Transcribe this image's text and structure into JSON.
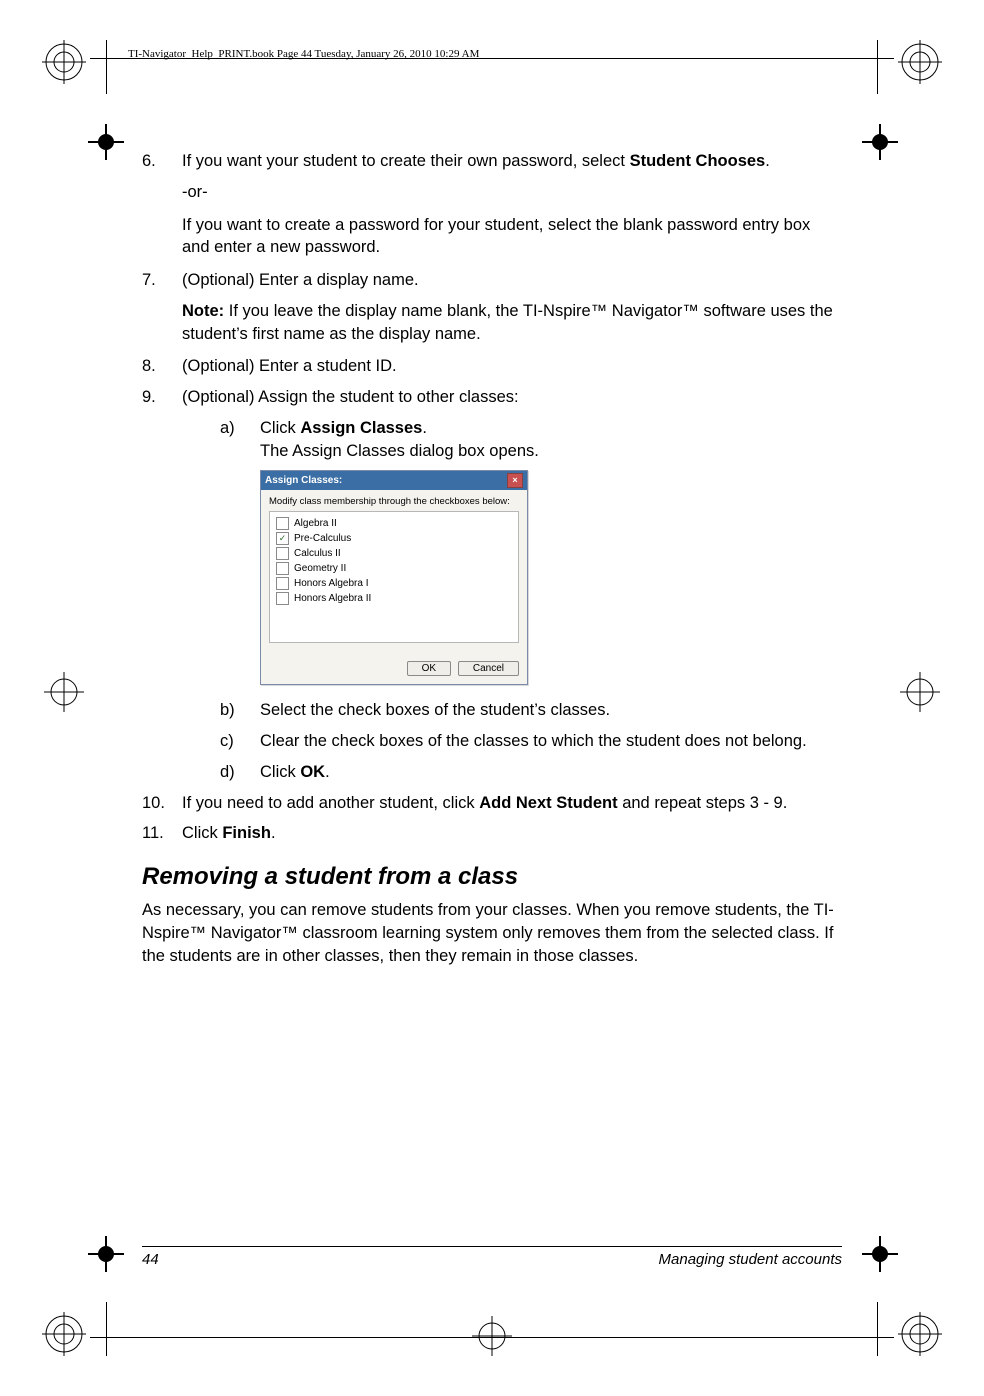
{
  "head_slug": "TI-Navigator_Help_PRINT.book  Page 44  Tuesday, January 26, 2010  10:29 AM",
  "step6": {
    "num": "6.",
    "text_a": "If you want your student to create their own password, select ",
    "bold_a": "Student Chooses",
    "text_b": ".",
    "or": "-or-",
    "text_c": "If you want to create a password for your student, select the blank password entry box and enter a new password."
  },
  "step7": {
    "num": "7.",
    "text": "(Optional) Enter a display name.",
    "note_label": "Note:",
    "note_text": " If you leave the display name blank, the TI-Nspire™ Navigator™ software uses the student’s first name as the display name."
  },
  "step8": {
    "num": "8.",
    "text": "(Optional) Enter a student ID."
  },
  "step9": {
    "num": "9.",
    "text": "(Optional) Assign the student to other classes:",
    "a_lbl": "a)",
    "a_line1": "Click ",
    "a_bold": "Assign Classes",
    "a_line1b": ".",
    "a_line2": "The Assign Classes dialog box opens.",
    "b_lbl": "b)",
    "b_text": "Select the check boxes of the student’s classes.",
    "c_lbl": "c)",
    "c_text": "Clear the check boxes of the classes to which the student does not belong.",
    "d_lbl": "d)",
    "d_text_a": "Click ",
    "d_bold": "OK",
    "d_text_b": "."
  },
  "step10": {
    "num": "10.",
    "text_a": "If you need to add another student, click ",
    "bold": "Add Next Student",
    "text_b": " and repeat steps 3 - 9."
  },
  "step11": {
    "num": "11.",
    "text_a": "Click ",
    "bold": "Finish",
    "text_b": "."
  },
  "section_heading": "Removing a student from a class",
  "section_para": "As necessary, you can remove students from your classes. When you remove students, the TI-Nspire™ Navigator™ classroom learning system only removes them from the selected class. If the students are in other classes, then they remain in those classes.",
  "footer": {
    "page": "44",
    "chapter": "Managing student accounts"
  },
  "dialog": {
    "title": "Assign Classes:",
    "caption": "Modify class membership through the checkboxes below:",
    "items": [
      {
        "checked": false,
        "label": "Algebra II"
      },
      {
        "checked": true,
        "label": "Pre-Calculus"
      },
      {
        "checked": false,
        "label": "Calculus II"
      },
      {
        "checked": false,
        "label": "Geometry II"
      },
      {
        "checked": false,
        "label": "Honors Algebra I"
      },
      {
        "checked": false,
        "label": "Honors Algebra II"
      }
    ],
    "ok": "OK",
    "cancel": "Cancel"
  }
}
